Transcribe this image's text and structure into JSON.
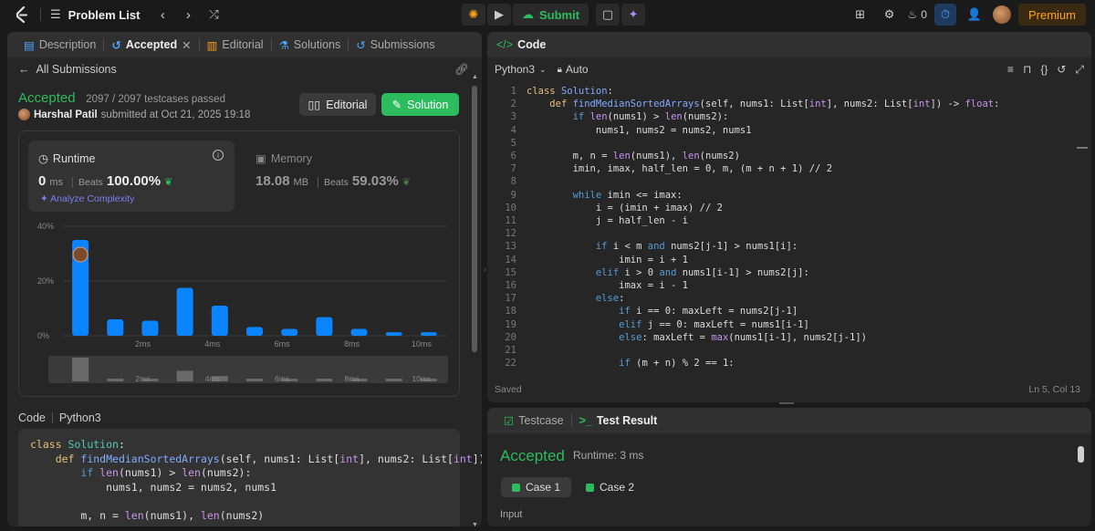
{
  "topbar": {
    "problem_list": "Problem List",
    "submit": "Submit",
    "streak": "0",
    "premium": "Premium"
  },
  "left_tabs": [
    {
      "label": "Description"
    },
    {
      "label": "Accepted"
    },
    {
      "label": "Editorial"
    },
    {
      "label": "Solutions"
    },
    {
      "label": "Submissions"
    }
  ],
  "submission": {
    "back_label": "All Submissions",
    "status": "Accepted",
    "testcases": "2097 / 2097 testcases passed",
    "user": "Harshal Patil",
    "submitted_text": "submitted at Oct 21, 2025 19:18",
    "editorial_btn": "Editorial",
    "solution_btn": "Solution"
  },
  "runtime": {
    "label": "Runtime",
    "value": "0",
    "unit": "ms",
    "beats_label": "Beats",
    "beats_pct": "100.00%",
    "analyze": "Analyze Complexity"
  },
  "memory": {
    "label": "Memory",
    "value": "18.08",
    "unit": "MB",
    "beats_label": "Beats",
    "beats_pct": "59.03%"
  },
  "chart_data": {
    "type": "bar",
    "yticks": [
      "40%",
      "20%",
      "0%"
    ],
    "ylim": [
      0,
      40
    ],
    "xticks": [
      "2ms",
      "4ms",
      "6ms",
      "8ms",
      "10ms"
    ],
    "values": [
      35,
      6,
      5.5,
      17.5,
      11,
      3.2,
      2.5,
      6.8,
      2.5,
      1.3,
      1.3
    ],
    "highlight_index": 0,
    "bar_color": "#0a84ff",
    "overview_values": [
      9,
      1,
      1,
      4,
      2,
      1,
      1,
      1,
      1,
      1,
      1
    ]
  },
  "code_preview": {
    "header": "Code",
    "language": "Python3",
    "lines": [
      "class Solution:",
      "    def findMedianSortedArrays(self, nums1: List[int], nums2: List[int])",
      "        if len(nums1) > len(nums2):",
      "            nums1, nums2 = nums2, nums1",
      "",
      "        m, n = len(nums1), len(nums2)"
    ]
  },
  "editor": {
    "title": "Code",
    "language": "Python3",
    "mode": "Auto",
    "saved": "Saved",
    "cursor": "Ln 5, Col 13",
    "lines": [
      "class Solution:",
      "    def findMedianSortedArrays(self, nums1: List[int], nums2: List[int]) -> float:",
      "        if len(nums1) > len(nums2):",
      "            nums1, nums2 = nums2, nums1",
      "",
      "        m, n = len(nums1), len(nums2)",
      "        imin, imax, half_len = 0, m, (m + n + 1) // 2",
      "",
      "        while imin <= imax:",
      "            i = (imin + imax) // 2",
      "            j = half_len - i",
      "",
      "            if i < m and nums2[j-1] > nums1[i]:",
      "                imin = i + 1",
      "            elif i > 0 and nums1[i-1] > nums2[j]:",
      "                imax = i - 1",
      "            else:",
      "                if i == 0: maxLeft = nums2[j-1]",
      "                elif j == 0: maxLeft = nums1[i-1]",
      "                else: maxLeft = max(nums1[i-1], nums2[j-1])",
      "",
      "                if (m + n) % 2 == 1:"
    ]
  },
  "test": {
    "tab_testcase": "Testcase",
    "tab_result": "Test Result",
    "status": "Accepted",
    "runtime": "Runtime: 3 ms",
    "cases": [
      "Case 1",
      "Case 2"
    ],
    "input_label": "Input"
  }
}
